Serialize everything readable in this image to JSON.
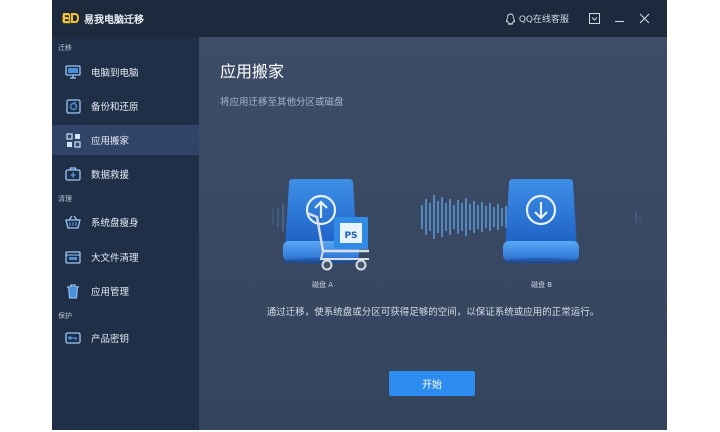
{
  "app": {
    "title": "易我电脑迁移"
  },
  "titlebar": {
    "qq_label": "QQ在线客服"
  },
  "sidebar": {
    "sections": [
      {
        "label": "迁移",
        "items": [
          {
            "label": "电脑到电脑",
            "icon": "monitor-icon"
          },
          {
            "label": "备份和还原",
            "icon": "backup-icon"
          },
          {
            "label": "应用搬家",
            "icon": "apps-icon",
            "active": true
          },
          {
            "label": "数据救援",
            "icon": "rescue-kit-icon"
          }
        ]
      },
      {
        "label": "清理",
        "items": [
          {
            "label": "系统盘瘦身",
            "icon": "basket-icon"
          },
          {
            "label": "大文件清理",
            "icon": "large-file-icon"
          },
          {
            "label": "应用管理",
            "icon": "trash-icon"
          }
        ]
      },
      {
        "label": "保护",
        "items": [
          {
            "label": "产品密钥",
            "icon": "key-icon"
          }
        ]
      }
    ]
  },
  "main": {
    "title": "应用搬家",
    "subtitle": "将应用迁移至其他分区或磁盘",
    "disk_a": "磁盘 A",
    "disk_b": "磁盘 B",
    "badge": "PS",
    "description": "通过迁移，使系统盘或分区可获得足够的空间，以保证系统或应用的正常运行。",
    "start_label": "开始"
  },
  "colors": {
    "accent": "#2c8cf0",
    "sidebar_bg": "#1f2f47",
    "titlebar_bg": "#1d2a3e",
    "main_bg": "#3a4a63",
    "active_item": "#2f4466"
  }
}
